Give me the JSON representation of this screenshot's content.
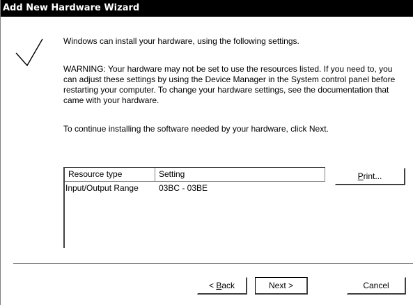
{
  "window": {
    "title": "Add New Hardware Wizard"
  },
  "content": {
    "line1": "Windows can install your hardware, using the following settings.",
    "warning": "WARNING:  Your hardware may not be set to use the resources listed. If you need to, you can adjust these settings by using the Device Manager in the System control panel before restarting your computer. To change your hardware settings, see the documentation that came with your hardware.",
    "continue_text": "To continue installing the software needed by your hardware, click Next."
  },
  "resources": {
    "columns": [
      "Resource type",
      "Setting"
    ],
    "rows": [
      {
        "type": "Input/Output Range",
        "setting": "03BC - 03BE"
      }
    ]
  },
  "buttons": {
    "print": {
      "prefix": "",
      "underline": "P",
      "suffix": "rint..."
    },
    "back": {
      "prefix": "< ",
      "underline": "B",
      "suffix": "ack"
    },
    "next": "Next >",
    "cancel": "Cancel"
  },
  "icons": {
    "wizard": "checkmark-arrow-icon"
  }
}
